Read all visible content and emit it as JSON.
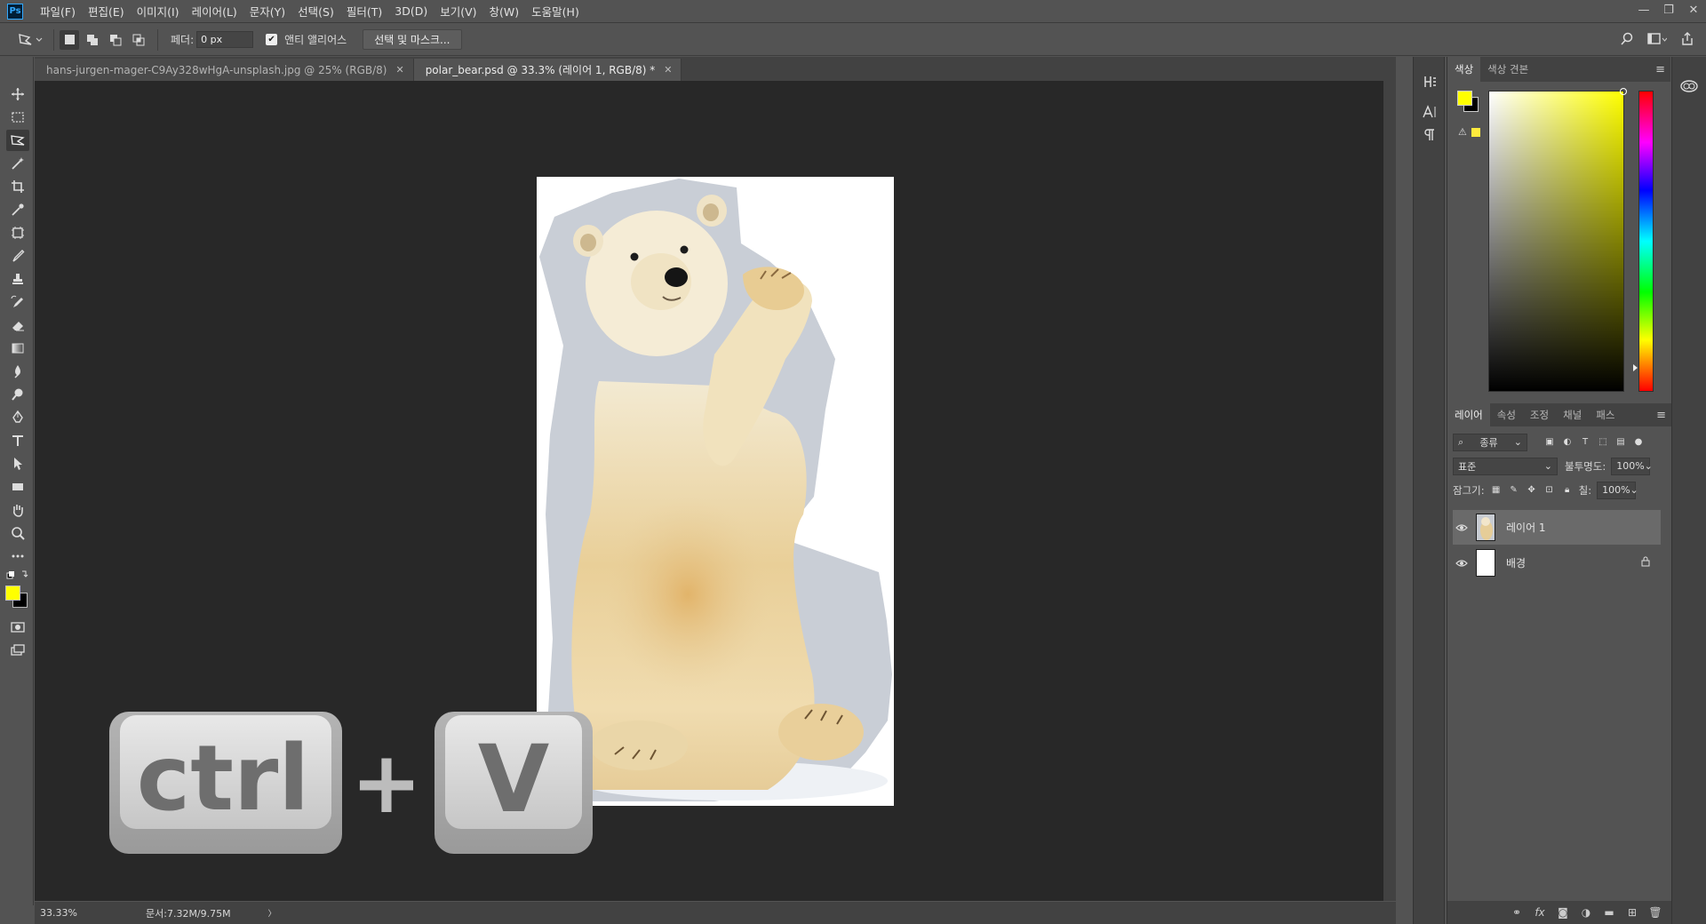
{
  "app": {
    "logo": "Ps"
  },
  "menu": [
    "파일(F)",
    "편집(E)",
    "이미지(I)",
    "레이어(L)",
    "문자(Y)",
    "선택(S)",
    "필터(T)",
    "3D(D)",
    "보기(V)",
    "창(W)",
    "도움말(H)"
  ],
  "options": {
    "feather_label": "페더:",
    "feather_value": "0 px",
    "antialias_label": "앤티 앨리어스",
    "select_mask_label": "선택 및 마스크..."
  },
  "tabs": [
    {
      "label": "hans-jurgen-mager-C9Ay328wHgA-unsplash.jpg @ 25% (RGB/8)",
      "active": false
    },
    {
      "label": "polar_bear.psd @ 33.3% (레이어 1, RGB/8) *",
      "active": true
    }
  ],
  "overlay": {
    "key1": "ctrl",
    "plus": "+",
    "key2": "V"
  },
  "status": {
    "zoom": "33.33%",
    "doc": "문서:7.32M/9.75M",
    "arrow": "〉"
  },
  "color_panel": {
    "tabs": [
      "색상",
      "색상 견본"
    ],
    "foreground": "#ffff00",
    "background": "#000000"
  },
  "layers_panel": {
    "tabs": [
      "레이어",
      "속성",
      "조정",
      "채널",
      "패스"
    ],
    "filter_label": "종류",
    "blend_mode": "표준",
    "opacity_label": "불투명도:",
    "opacity_value": "100%",
    "lock_label": "잠그기:",
    "fill_label": "칠:",
    "fill_value": "100%",
    "layers": [
      {
        "name": "레이어 1",
        "selected": true,
        "locked": false
      },
      {
        "name": "배경",
        "selected": false,
        "locked": true
      }
    ]
  },
  "colors": {
    "accent": "#31a8ff",
    "canvas": "#282828",
    "panel": "#535353"
  }
}
